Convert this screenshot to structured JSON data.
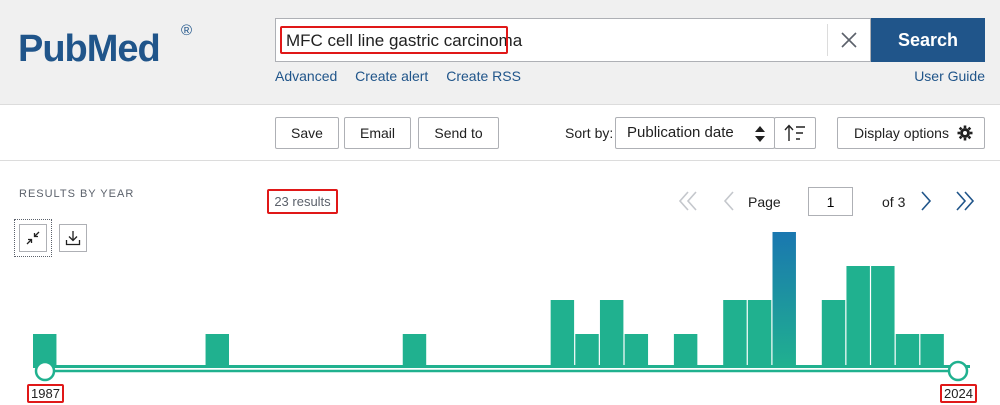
{
  "header": {
    "logo_text": "PubMed",
    "logo_reg": "®",
    "search_value": "MFC cell line gastric carcinoma",
    "search_button": "Search",
    "links": [
      "Advanced",
      "Create alert",
      "Create RSS"
    ],
    "user_guide": "User Guide"
  },
  "toolbar": {
    "save": "Save",
    "email": "Email",
    "send_to": "Send to",
    "sort_by_label": "Sort by:",
    "sort_value": "Publication date",
    "display_options": "Display options"
  },
  "results": {
    "section_title": "RESULTS BY YEAR",
    "count": "23 results",
    "page_label": "Page",
    "page_value": "1",
    "page_of": "of 3"
  },
  "chart_data": {
    "type": "bar",
    "categories": [
      "1987",
      "1988",
      "1989",
      "1990",
      "1991",
      "1992",
      "1993",
      "1994",
      "1995",
      "1996",
      "1997",
      "1998",
      "1999",
      "2000",
      "2001",
      "2002",
      "2003",
      "2004",
      "2005",
      "2006",
      "2007",
      "2008",
      "2009",
      "2010",
      "2011",
      "2012",
      "2013",
      "2014",
      "2015",
      "2016",
      "2017",
      "2018",
      "2019",
      "2020",
      "2021",
      "2022",
      "2023",
      "2024"
    ],
    "values": [
      1,
      0,
      0,
      0,
      0,
      0,
      0,
      1,
      0,
      0,
      0,
      0,
      0,
      0,
      0,
      1,
      0,
      0,
      0,
      0,
      0,
      2,
      1,
      2,
      1,
      0,
      1,
      0,
      2,
      2,
      4,
      0,
      2,
      3,
      3,
      1,
      1,
      0
    ],
    "start_label": "1987",
    "end_label": "2024",
    "bar_color": "#20b18f",
    "max_bar_color": "#1a77b0"
  }
}
